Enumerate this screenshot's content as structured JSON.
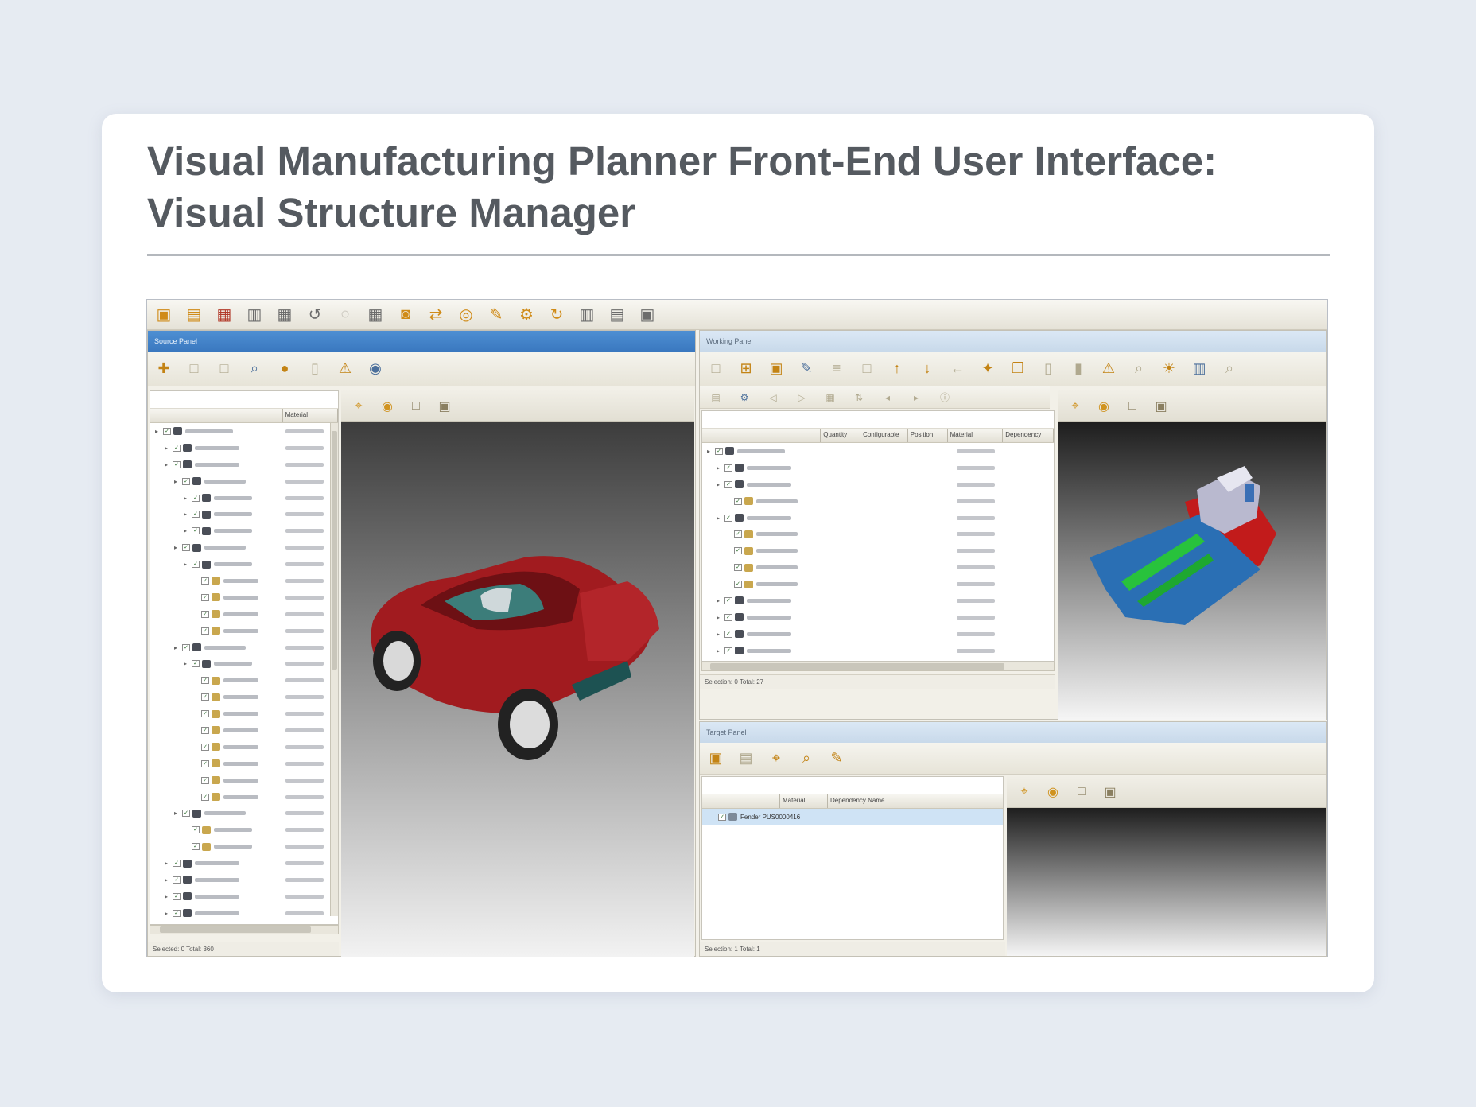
{
  "slide": {
    "title_line1": "Visual Manufacturing Planner Front-End User Interface:",
    "title_line2": "Visual Structure Manager"
  },
  "app": {
    "main_toolbar": [
      {
        "icon": "save-icon",
        "glyph": "▣",
        "tone": "orange"
      },
      {
        "icon": "folder-icon",
        "glyph": "▤",
        "tone": "orange"
      },
      {
        "icon": "report-icon",
        "glyph": "▦",
        "tone": "red"
      },
      {
        "icon": "print-icon",
        "glyph": "▥",
        "tone": "dark"
      },
      {
        "icon": "grid-icon",
        "glyph": "▦",
        "tone": "dark"
      },
      {
        "icon": "undo-icon",
        "glyph": "↺",
        "tone": "dark"
      },
      {
        "icon": "redo-icon",
        "glyph": "○",
        "tone": "faded"
      },
      {
        "icon": "table-icon",
        "glyph": "▦",
        "tone": "dark"
      },
      {
        "icon": "camera-icon",
        "glyph": "◙",
        "tone": "orange"
      },
      {
        "icon": "swap-icon",
        "glyph": "⇄",
        "tone": "orange"
      },
      {
        "icon": "search-part-icon",
        "glyph": "◎",
        "tone": "orange"
      },
      {
        "icon": "pencil-icon",
        "glyph": "✎",
        "tone": "orange"
      },
      {
        "icon": "gear-icon",
        "glyph": "⚙",
        "tone": "orange"
      },
      {
        "icon": "refresh-icon",
        "glyph": "↻",
        "tone": "orange"
      },
      {
        "icon": "columns-icon",
        "glyph": "▥",
        "tone": "dark"
      },
      {
        "icon": "document-icon",
        "glyph": "▤",
        "tone": "dark"
      },
      {
        "icon": "lock-icon",
        "glyph": "▣",
        "tone": "dark"
      }
    ],
    "left_pane": {
      "header": "Source Panel",
      "toolbar": [
        {
          "icon": "add-icon",
          "glyph": "✚",
          "tone": "on"
        },
        {
          "icon": "blank-icon",
          "glyph": "□",
          "tone": ""
        },
        {
          "icon": "blank2-icon",
          "glyph": "□",
          "tone": ""
        },
        {
          "icon": "find-icon",
          "glyph": "⌕",
          "tone": "blue"
        },
        {
          "icon": "sphere-icon",
          "glyph": "●",
          "tone": "on"
        },
        {
          "icon": "note-icon",
          "glyph": "▯",
          "tone": ""
        },
        {
          "icon": "warning-icon",
          "glyph": "⚠",
          "tone": "on"
        },
        {
          "icon": "magnifier-icon",
          "glyph": "◉",
          "tone": "blue"
        }
      ],
      "column_header": "Material",
      "status": "Selected: 0    Total: 360"
    },
    "right_top_pane": {
      "header": "Working Panel",
      "toolbar": [
        {
          "icon": "pin-icon",
          "glyph": "□",
          "tone": ""
        },
        {
          "icon": "hierarchy-icon",
          "glyph": "⊞",
          "tone": "on"
        },
        {
          "icon": "box-icon",
          "glyph": "▣",
          "tone": "on"
        },
        {
          "icon": "edit-icon",
          "glyph": "✎",
          "tone": "blue"
        },
        {
          "icon": "list-icon",
          "glyph": "≡",
          "tone": ""
        },
        {
          "icon": "blank-icon",
          "glyph": "□",
          "tone": ""
        },
        {
          "icon": "arrow-up-icon",
          "glyph": "↑",
          "tone": "on"
        },
        {
          "icon": "arrow-down-icon",
          "glyph": "↓",
          "tone": "on"
        },
        {
          "icon": "arrow-left-icon",
          "glyph": "←",
          "tone": ""
        },
        {
          "icon": "component-icon",
          "glyph": "✦",
          "tone": "on"
        },
        {
          "icon": "copy-icon",
          "glyph": "❐",
          "tone": "on"
        },
        {
          "icon": "page-icon",
          "glyph": "▯",
          "tone": ""
        },
        {
          "icon": "bookmark-icon",
          "glyph": "▮",
          "tone": ""
        },
        {
          "icon": "warning-icon",
          "glyph": "⚠",
          "tone": "on"
        },
        {
          "icon": "search-icon",
          "glyph": "⌕",
          "tone": ""
        },
        {
          "icon": "sun-icon",
          "glyph": "☀",
          "tone": "on"
        },
        {
          "icon": "barcode-icon",
          "glyph": "▥",
          "tone": "blue"
        },
        {
          "icon": "zoom-icon",
          "glyph": "⌕",
          "tone": ""
        }
      ],
      "column_headers": [
        "",
        "Quantity",
        "Configurable",
        "Position",
        "Material",
        "Dependency"
      ],
      "status": "Selection: 0    Total: 27"
    },
    "bottom_pane": {
      "header": "Target Panel",
      "column_headers": [
        "",
        "Material",
        "Dependency Name"
      ],
      "row": "Fender   PUS0000416",
      "status": "Selection: 1    Total: 1"
    }
  }
}
